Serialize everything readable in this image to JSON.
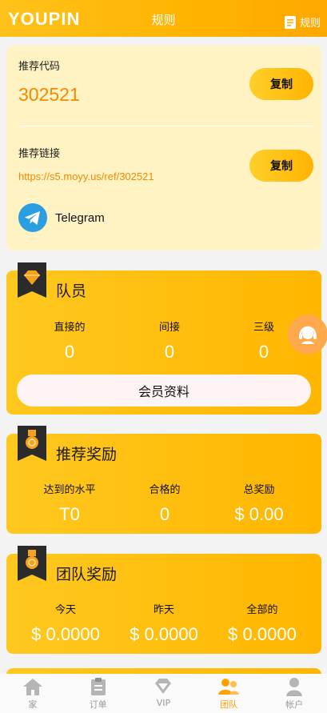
{
  "header": {
    "logo": "YOUPIN",
    "title": "规则",
    "rules_label": "规则"
  },
  "referral": {
    "code_label": "推荐代码",
    "code": "302521",
    "copy_label": "复制",
    "link_label": "推荐链接",
    "link": "https://s5.moyy.us/ref/302521",
    "telegram": "Telegram"
  },
  "team": {
    "title": "队员",
    "stats": [
      {
        "label": "直接的",
        "value": "0"
      },
      {
        "label": "间接",
        "value": "0"
      },
      {
        "label": "三级",
        "value": "0"
      }
    ],
    "member_button": "会员资料"
  },
  "referral_reward": {
    "title": "推荐奖励",
    "stats": [
      {
        "label": "达到的水平",
        "value": "T0"
      },
      {
        "label": "合格的",
        "value": "0"
      },
      {
        "label": "总奖励",
        "value": "$ 0.00"
      }
    ]
  },
  "team_reward": {
    "title": "团队奖励",
    "stats": [
      {
        "label": "今天",
        "value": "$ 0.0000"
      },
      {
        "label": "昨天",
        "value": "$ 0.0000"
      },
      {
        "label": "全部的",
        "value": "$ 0.0000"
      }
    ]
  },
  "nav": [
    {
      "label": "家",
      "icon": "home-icon"
    },
    {
      "label": "订单",
      "icon": "clipboard-icon"
    },
    {
      "label": "VIP",
      "icon": "diamond-icon"
    },
    {
      "label": "团队",
      "icon": "team-icon",
      "active": true
    },
    {
      "label": "帐户",
      "icon": "user-icon"
    }
  ],
  "colors": {
    "accent": "#ffb300",
    "code_text": "#f28a00",
    "active_nav": "#ffa200"
  }
}
